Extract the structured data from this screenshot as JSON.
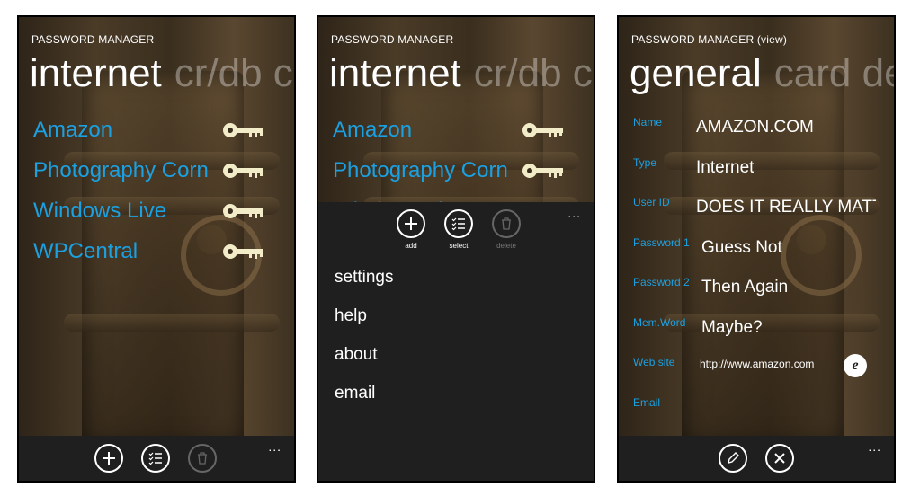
{
  "screens": [
    {
      "app_title": "PASSWORD MANAGER",
      "pivot_active": "internet",
      "pivot_inactive": "cr/db c",
      "items": [
        {
          "label": "Amazon"
        },
        {
          "label": "Photography Corn"
        },
        {
          "label": "Windows Live"
        },
        {
          "label": "WPCentral"
        }
      ],
      "appbar": {
        "ellipsis": "...",
        "buttons": [
          {
            "icon": "add-icon",
            "enabled": true
          },
          {
            "icon": "select-icon",
            "enabled": true
          },
          {
            "icon": "delete-icon",
            "enabled": false
          }
        ]
      }
    },
    {
      "app_title": "PASSWORD MANAGER",
      "pivot_active": "internet",
      "pivot_inactive": "cr/db c",
      "items": [
        {
          "label": "Amazon"
        },
        {
          "label": "Photography Corn"
        },
        {
          "label": "Windows Li"
        }
      ],
      "appbar": {
        "ellipsis": "...",
        "buttons": [
          {
            "icon": "add-icon",
            "label": "add",
            "enabled": true
          },
          {
            "icon": "select-icon",
            "label": "select",
            "enabled": true
          },
          {
            "icon": "delete-icon",
            "label": "delete",
            "enabled": false
          }
        ],
        "menu_items": [
          "settings",
          "help",
          "about",
          "email"
        ]
      }
    },
    {
      "app_title": "PASSWORD MANAGER (view)",
      "pivot_active": "general",
      "pivot_inactive": "card de",
      "fields": [
        {
          "label": "Name",
          "value": "AMAZON.COM"
        },
        {
          "label": "Type",
          "value": "Internet"
        },
        {
          "label": "User ID",
          "value": "DOES IT REALLY MATTE"
        },
        {
          "label": "Password 1",
          "value": "Guess Not"
        },
        {
          "label": "Password 2",
          "value": "Then Again"
        },
        {
          "label": "Mem.Word",
          "value": "Maybe?"
        },
        {
          "label": "Web site",
          "value": "http://www.amazon.com"
        },
        {
          "label": "Email",
          "value": ""
        }
      ],
      "appbar": {
        "ellipsis": "...",
        "buttons": [
          {
            "icon": "edit-icon",
            "enabled": true
          },
          {
            "icon": "close-icon",
            "enabled": true
          }
        ]
      }
    }
  ],
  "colors": {
    "accent": "#1ba1e2",
    "appbar": "#1f1f1f",
    "key": "#f2ecc8"
  }
}
